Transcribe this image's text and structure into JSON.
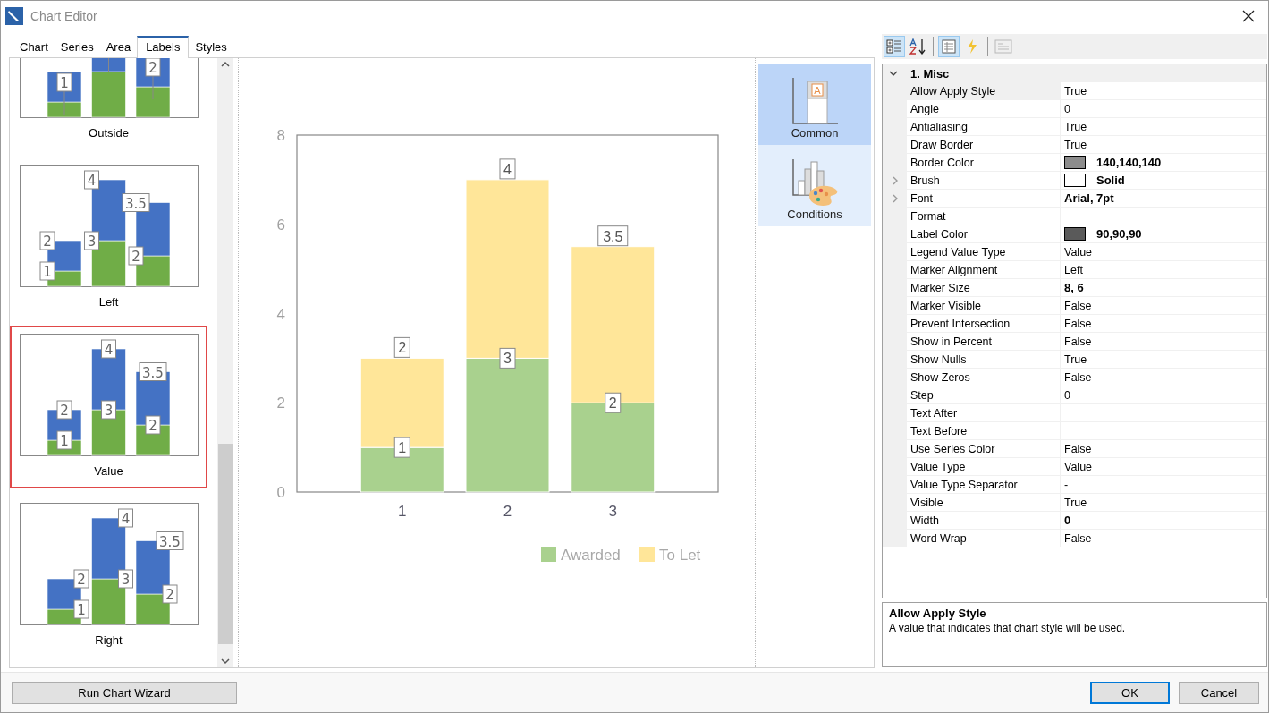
{
  "window": {
    "title": "Chart Editor"
  },
  "tabs": [
    {
      "label": "Chart",
      "selected": false
    },
    {
      "label": "Series",
      "selected": false
    },
    {
      "label": "Area",
      "selected": false
    },
    {
      "label": "Labels",
      "selected": true
    },
    {
      "label": "Styles",
      "selected": false
    }
  ],
  "label_styles": [
    {
      "label": "Outside",
      "kind": "outside",
      "selected": false,
      "bars": [
        {
          "lower": "1"
        },
        {
          "kind": "unlabelled"
        },
        {
          "lower": "2"
        }
      ]
    },
    {
      "label": "Left",
      "kind": "left",
      "selected": false,
      "bars": [
        {
          "lower": "1",
          "upper": "2"
        },
        {
          "lower": "3",
          "upper": "4"
        },
        {
          "lower": "2",
          "upper": "3.5"
        }
      ]
    },
    {
      "label": "Value",
      "kind": "value",
      "selected": true,
      "bars": [
        {
          "lower": "1",
          "upper": "2"
        },
        {
          "lower": "3",
          "upper": "4"
        },
        {
          "lower": "2",
          "upper": "3.5"
        }
      ]
    },
    {
      "label": "Right",
      "kind": "right",
      "selected": false,
      "bars": [
        {
          "lower": "1",
          "upper": "2"
        },
        {
          "lower": "3",
          "upper": "4"
        },
        {
          "lower": "2",
          "upper": "3.5"
        }
      ]
    }
  ],
  "preview": {
    "chart_data": {
      "type": "bar",
      "stacked": true,
      "data_labels": true,
      "legend": "bottom-right",
      "categories": [
        "1",
        "2",
        "3"
      ],
      "ylim": [
        0,
        8
      ],
      "yticks": [
        0,
        2,
        4,
        6,
        8
      ],
      "series": [
        {
          "name": "Awarded",
          "color": "#a9d18e",
          "values": [
            1,
            3,
            2
          ]
        },
        {
          "name": "To Let",
          "color": "#ffe699",
          "values": [
            2,
            4,
            3.5
          ]
        }
      ]
    }
  },
  "categories": [
    {
      "label": "Common",
      "kind": "common",
      "badge": "A",
      "selected": true
    },
    {
      "label": "Conditions",
      "kind": "conditions",
      "selected": false
    }
  ],
  "property_toolbar": [
    {
      "kind": "categorized",
      "selected": true,
      "disabled": false
    },
    {
      "kind": "alphabetical",
      "selected": false,
      "disabled": false
    },
    {
      "kind": "properties",
      "selected": true,
      "disabled": false
    },
    {
      "kind": "events",
      "selected": false,
      "disabled": false
    },
    {
      "kind": "pages",
      "selected": false,
      "disabled": true
    }
  ],
  "property_group": {
    "title": "1. Misc",
    "expanded": true
  },
  "properties": [
    {
      "name": "Allow Apply Style",
      "value": "True",
      "bold": false,
      "expandable": false,
      "selected": true
    },
    {
      "name": "Angle",
      "value": "0",
      "bold": false,
      "expandable": false,
      "selected": false
    },
    {
      "name": "Antialiasing",
      "value": "True",
      "bold": false,
      "expandable": false,
      "selected": false
    },
    {
      "name": "Draw Border",
      "value": "True",
      "bold": false,
      "expandable": false,
      "selected": false
    },
    {
      "name": "Border Color",
      "value": "140,140,140",
      "color": "#8c8c8c",
      "bold": true,
      "expandable": false,
      "selected": false
    },
    {
      "name": "Brush",
      "value": "Solid",
      "color": "#ffffff",
      "bold": true,
      "expandable": true,
      "selected": false
    },
    {
      "name": "Font",
      "value": "Arial, 7pt",
      "bold": true,
      "expandable": true,
      "selected": false
    },
    {
      "name": "Format",
      "expandable": false,
      "selected": false
    },
    {
      "name": "Label Color",
      "value": "90,90,90",
      "color": "#5a5a5a",
      "bold": true,
      "expandable": false,
      "selected": false
    },
    {
      "name": "Legend Value Type",
      "value": "Value",
      "bold": false,
      "expandable": false,
      "selected": false
    },
    {
      "name": "Marker Alignment",
      "value": "Left",
      "bold": false,
      "expandable": false,
      "selected": false
    },
    {
      "name": "Marker Size",
      "value": "8, 6",
      "bold": true,
      "expandable": false,
      "selected": false
    },
    {
      "name": "Marker Visible",
      "value": "False",
      "bold": false,
      "expandable": false,
      "selected": false
    },
    {
      "name": "Prevent Intersection",
      "value": "False",
      "bold": false,
      "expandable": false,
      "selected": false
    },
    {
      "name": "Show in Percent",
      "value": "False",
      "bold": false,
      "expandable": false,
      "selected": false
    },
    {
      "name": "Show Nulls",
      "value": "True",
      "bold": false,
      "expandable": false,
      "selected": false
    },
    {
      "name": "Show Zeros",
      "value": "False",
      "bold": false,
      "expandable": false,
      "selected": false
    },
    {
      "name": "Step",
      "value": "0",
      "bold": false,
      "expandable": false,
      "selected": false
    },
    {
      "name": "Text After",
      "expandable": false,
      "selected": false
    },
    {
      "name": "Text Before",
      "expandable": false,
      "selected": false
    },
    {
      "name": "Use Series Color",
      "value": "False",
      "bold": false,
      "expandable": false,
      "selected": false
    },
    {
      "name": "Value Type",
      "value": "Value",
      "bold": false,
      "expandable": false,
      "selected": false
    },
    {
      "name": "Value Type Separator",
      "value": "-",
      "bold": false,
      "expandable": false,
      "selected": false
    },
    {
      "name": "Visible",
      "value": "True",
      "bold": false,
      "expandable": false,
      "selected": false
    },
    {
      "name": "Width",
      "value": "0",
      "bold": true,
      "expandable": false,
      "selected": false
    },
    {
      "name": "Word Wrap",
      "value": "False",
      "bold": false,
      "expandable": false,
      "selected": false
    }
  ],
  "description": {
    "title": "Allow Apply Style",
    "text": "A value that indicates that chart style will be used."
  },
  "buttons": [
    {
      "label": "Run Chart Wizard",
      "kind": "wizard",
      "default": false
    },
    {
      "label": "OK",
      "kind": "ok",
      "default": true
    },
    {
      "label": "Cancel",
      "kind": "cancel",
      "default": false
    }
  ]
}
